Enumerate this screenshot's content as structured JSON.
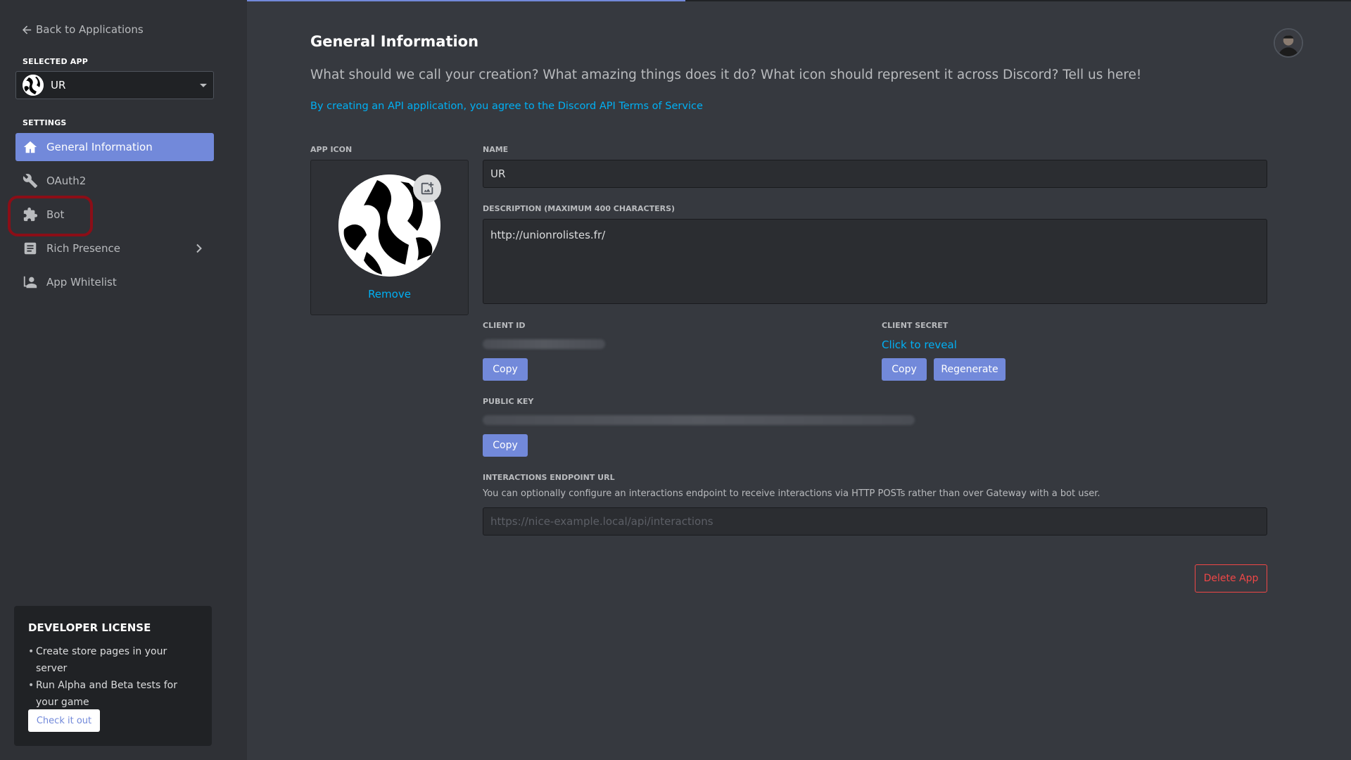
{
  "sidebar": {
    "back_label": "Back to Applications",
    "selected_app_label": "SELECTED APP",
    "selected_app_name": "UR",
    "settings_label": "SETTINGS",
    "items": [
      {
        "label": "General Information",
        "icon": "home-icon",
        "active": true
      },
      {
        "label": "OAuth2",
        "icon": "wrench-icon"
      },
      {
        "label": "Bot",
        "icon": "puzzle-icon",
        "highlighted": true
      },
      {
        "label": "Rich Presence",
        "icon": "document-icon",
        "has_submenu": true
      },
      {
        "label": "App Whitelist",
        "icon": "person-icon"
      }
    ]
  },
  "license": {
    "title": "DEVELOPER LICENSE",
    "bullets": [
      "Create store pages in your server",
      "Run Alpha and Beta tests for your game"
    ],
    "button": "Check it out"
  },
  "main": {
    "title": "General Information",
    "subtitle": "What should we call your creation? What amazing things does it do? What icon should represent it across Discord? Tell us here!",
    "terms_link": "By creating an API application, you agree to the Discord API Terms of Service",
    "app_icon_label": "APP ICON",
    "remove_label": "Remove",
    "name_label": "NAME",
    "name_value": "UR",
    "description_label": "DESCRIPTION (MAXIMUM 400 CHARACTERS)",
    "description_value": "http://unionrolistes.fr/",
    "client_id_label": "CLIENT ID",
    "client_secret_label": "CLIENT SECRET",
    "client_secret_reveal": "Click to reveal",
    "copy_label": "Copy",
    "regenerate_label": "Regenerate",
    "public_key_label": "PUBLIC KEY",
    "interactions_label": "INTERACTIONS ENDPOINT URL",
    "interactions_help": "You can optionally configure an interactions endpoint to receive interactions via HTTP POSTs rather than over Gateway with a bot user.",
    "interactions_placeholder": "https://nice-example.local/api/interactions",
    "delete_label": "Delete App"
  },
  "colors": {
    "accent": "#7289da",
    "link": "#00b0f4",
    "danger": "#f04747",
    "highlight_ring": "#8b0e17"
  }
}
